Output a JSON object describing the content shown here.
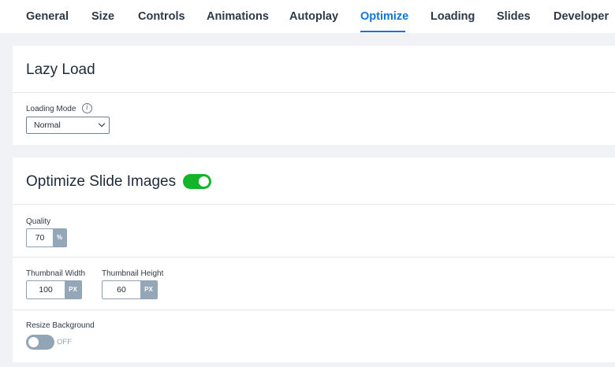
{
  "tabs": [
    {
      "label": "General"
    },
    {
      "label": "Size"
    },
    {
      "label": "Controls"
    },
    {
      "label": "Animations"
    },
    {
      "label": "Autoplay"
    },
    {
      "label": "Optimize"
    },
    {
      "label": "Loading"
    },
    {
      "label": "Slides"
    },
    {
      "label": "Developer"
    }
  ],
  "active_tab": "Optimize",
  "lazy_load": {
    "title": "Lazy Load",
    "loading_mode": {
      "label": "Loading Mode",
      "info_icon": "info-icon",
      "value": "Normal"
    }
  },
  "optimize_images": {
    "title": "Optimize Slide Images",
    "enabled": true,
    "quality": {
      "label": "Quality",
      "value": "70",
      "unit": "%"
    },
    "thumbnail_width": {
      "label": "Thumbnail Width",
      "value": "100",
      "unit": "PX"
    },
    "thumbnail_height": {
      "label": "Thumbnail Height",
      "value": "60",
      "unit": "PX"
    },
    "resize_background": {
      "label": "Resize Background",
      "state_text": "OFF",
      "enabled": false
    }
  },
  "colors": {
    "accent": "#1375d6",
    "toggle_on": "#12b52a",
    "toggle_off": "#91a5b6"
  }
}
